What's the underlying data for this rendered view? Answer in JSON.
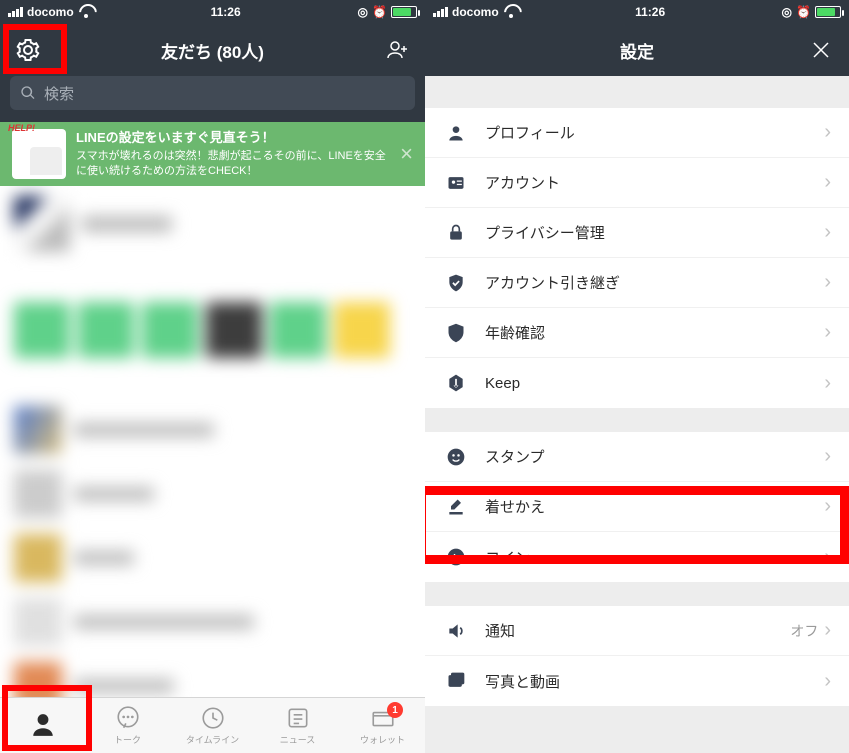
{
  "statusbar": {
    "carrier": "docomo",
    "time": "11:26"
  },
  "left": {
    "title": "友だち (80人)",
    "search_placeholder": "検索",
    "banner": {
      "title": "LINEの設定をいますぐ見直そう！",
      "subtitle": "スマホが壊れるのは突然！悲劇が起こるその前に、LINEを安全に使い続けるための方法をCHECK！"
    },
    "tabs": {
      "friends": "",
      "talk": "トーク",
      "timeline": "タイムライン",
      "news": "ニュース",
      "wallet": "ウォレット",
      "wallet_badge": "1"
    }
  },
  "right": {
    "title": "設定",
    "section1": [
      {
        "icon": "person-icon",
        "label": "プロフィール"
      },
      {
        "icon": "id-card-icon",
        "label": "アカウント"
      },
      {
        "icon": "lock-icon",
        "label": "プライバシー管理"
      },
      {
        "icon": "shield-check-icon",
        "label": "アカウント引き継ぎ"
      },
      {
        "icon": "shield-icon",
        "label": "年齢確認"
      },
      {
        "icon": "hex-icon",
        "label": "Keep"
      }
    ],
    "section2": [
      {
        "icon": "smile-icon",
        "label": "スタンプ"
      },
      {
        "icon": "brush-icon",
        "label": "着せかえ"
      },
      {
        "icon": "coin-l-icon",
        "label": "コイン"
      }
    ],
    "section3": [
      {
        "icon": "speaker-icon",
        "label": "通知",
        "value": "オフ"
      },
      {
        "icon": "photo-icon",
        "label": "写真と動画"
      }
    ]
  }
}
